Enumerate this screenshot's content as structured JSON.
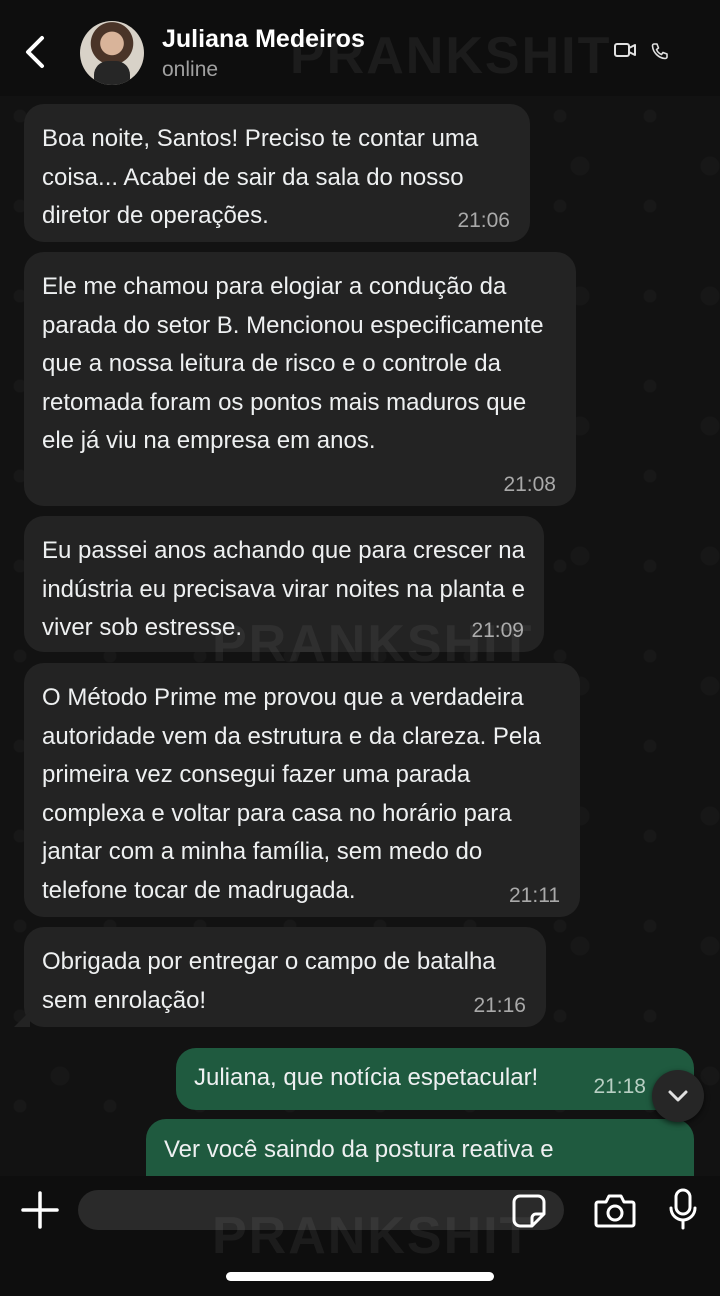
{
  "header": {
    "contact_name": "Juliana Medeiros",
    "status": "online"
  },
  "watermark": "PRANKSHIT",
  "messages": [
    {
      "direction": "in",
      "text": "Boa noite, Santos! Preciso te contar uma coisa... Acabei de sair da sala do nosso diretor de operações.",
      "time": "21:06"
    },
    {
      "direction": "in",
      "text": "Ele me chamou para elogiar a condução da parada do setor B. Mencionou especificamente que a nossa leitura de risco e o controle da retomada foram os pontos mais maduros que ele já viu na empresa em anos.",
      "time": "21:08"
    },
    {
      "direction": "in",
      "text": "Eu passei anos achando que para crescer na indústria eu precisava virar noites na planta e viver sob estresse.",
      "time": "21:09"
    },
    {
      "direction": "in",
      "text": "O Método Prime me provou que a verdadeira autoridade vem da estrutura e da clareza. Pela primeira vez consegui fazer uma parada complexa e voltar para casa no horário para jantar com a minha família, sem medo do telefone tocar de madrugada.",
      "time": "21:11"
    },
    {
      "direction": "in",
      "text": "Obrigada por entregar o campo de batalha sem enrolação!",
      "time": "21:16"
    },
    {
      "direction": "out",
      "text": "Juliana, que notícia espetacular!",
      "time": "21:18"
    },
    {
      "direction": "out",
      "text": "Ver você saindo da postura reativa e",
      "time": ""
    }
  ],
  "composer": {
    "placeholder": ""
  },
  "icons": {
    "back": "chevron-left-icon",
    "video": "video-camera-icon",
    "phone": "phone-icon",
    "plus": "plus-icon",
    "sticker": "sticker-icon",
    "camera": "camera-icon",
    "mic": "microphone-icon",
    "scroll": "chevron-down-icon"
  },
  "colors": {
    "incoming_bubble": "#232323",
    "outgoing_bubble": "#1f5a3f",
    "background": "#121212"
  }
}
